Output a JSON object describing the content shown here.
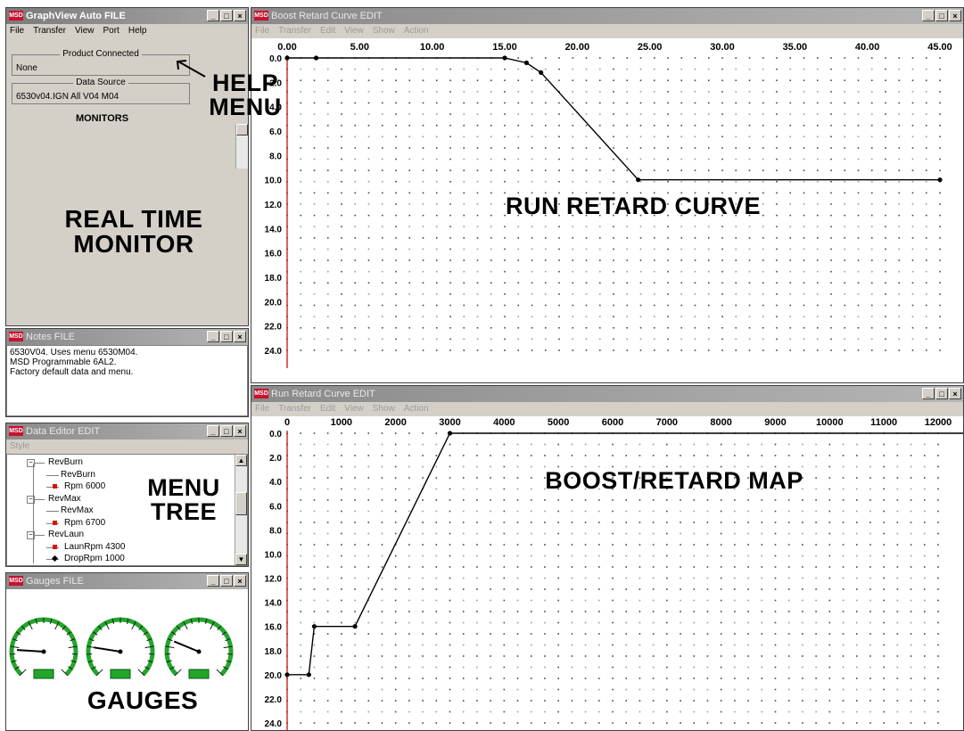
{
  "main_window": {
    "title": "GraphView Auto FILE",
    "menu": [
      "File",
      "Transfer",
      "View",
      "Port",
      "Help"
    ],
    "product_connected_label": "Product Connected",
    "product_connected_value": "None",
    "data_source_label": "Data Source",
    "data_source_value": "6530v04.IGN All V04 M04",
    "monitors_label": "MONITORS"
  },
  "notes_window": {
    "title": "Notes FILE",
    "lines": [
      "6530V04. Uses menu 6530M04.",
      "MSD Programmable 6AL2.",
      "Factory default data and menu."
    ]
  },
  "data_editor_window": {
    "title": "Data Editor EDIT",
    "menu": "Style",
    "tree": [
      {
        "label": "RevBurn",
        "level": 0,
        "type": "folder"
      },
      {
        "label": "RevBurn",
        "level": 1,
        "type": "leaf"
      },
      {
        "label": "Rpm 6000",
        "level": 1,
        "type": "value"
      },
      {
        "label": "RevMax",
        "level": 0,
        "type": "folder"
      },
      {
        "label": "RevMax",
        "level": 1,
        "type": "leaf"
      },
      {
        "label": "Rpm 6700",
        "level": 1,
        "type": "value"
      },
      {
        "label": "RevLaun",
        "level": 0,
        "type": "folder"
      },
      {
        "label": "LaunRpm 4300",
        "level": 1,
        "type": "value"
      },
      {
        "label": "DropRpm 1000",
        "level": 1,
        "type": "value-black"
      }
    ]
  },
  "gauges_window": {
    "title": "Gauges FILE",
    "gauge_count": 3,
    "needle_fractions": [
      0.18,
      0.2,
      0.25
    ],
    "accent_color": "#22a62a"
  },
  "top_graph_window": {
    "title": "Boost Retard Curve EDIT",
    "menu": [
      "File",
      "Transfer",
      "Edit",
      "View",
      "Show",
      "Action"
    ]
  },
  "bottom_graph_window": {
    "title": "Run Retard Curve EDIT",
    "menu": [
      "File",
      "Transfer",
      "Edit",
      "View",
      "Show",
      "Action"
    ]
  },
  "annotations": {
    "help_menu": [
      "HELP",
      "MENU"
    ],
    "real_time_monitor": [
      "REAL TIME",
      "MONITOR"
    ],
    "menu_tree": [
      "MENU",
      "TREE"
    ],
    "gauges": "GAUGES",
    "run_retard_curve": "RUN RETARD CURVE",
    "boost_retard_map": "BOOST/RETARD MAP"
  },
  "chart_data": [
    {
      "type": "line",
      "x_ticks": [
        "0.00",
        "5.00",
        "10.00",
        "15.00",
        "20.00",
        "25.00",
        "30.00",
        "35.00",
        "40.00",
        "45.00"
      ],
      "y_ticks": [
        "0.0",
        "2.0",
        "4.0",
        "6.0",
        "8.0",
        "10.0",
        "12.0",
        "14.0",
        "16.0",
        "18.0",
        "20.0",
        "22.0",
        "24.0"
      ],
      "xlim": [
        0,
        45
      ],
      "ylim": [
        0,
        24
      ],
      "y_inverted": true,
      "x": [
        0,
        2,
        15,
        16.5,
        17.5,
        24.2,
        45
      ],
      "y": [
        0,
        0,
        0,
        0.4,
        1.2,
        10,
        10
      ]
    },
    {
      "type": "line",
      "x_ticks": [
        "0",
        "1000",
        "2000",
        "3000",
        "4000",
        "5000",
        "6000",
        "7000",
        "8000",
        "9000",
        "10000",
        "11000",
        "12000"
      ],
      "y_ticks": [
        "0.0",
        "2.0",
        "4.0",
        "6.0",
        "8.0",
        "10.0",
        "12.0",
        "14.0",
        "16.0",
        "18.0",
        "20.0",
        "22.0",
        "24.0"
      ],
      "xlim": [
        0,
        12000
      ],
      "ylim": [
        0,
        24
      ],
      "y_inverted": true,
      "x": [
        0,
        400,
        500,
        1250,
        3000,
        12800
      ],
      "y": [
        20,
        20,
        16,
        16,
        0,
        0
      ]
    }
  ]
}
